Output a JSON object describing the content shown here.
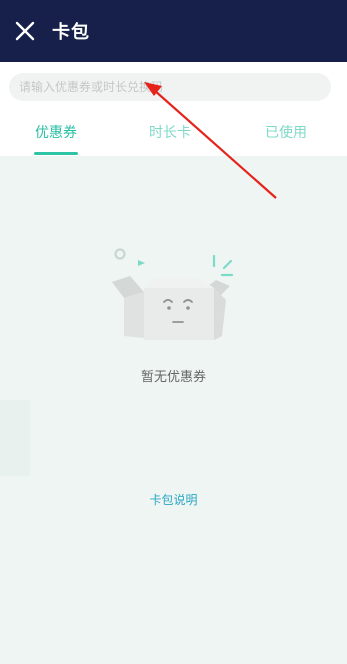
{
  "header": {
    "close_icon": "close-icon",
    "title": "卡包"
  },
  "search": {
    "placeholder": "请输入优惠券或时长兑换码",
    "value": ""
  },
  "tabs": [
    {
      "label": "优惠券",
      "active": true
    },
    {
      "label": "时长卡",
      "active": false
    },
    {
      "label": "已使用",
      "active": false
    }
  ],
  "empty_state": {
    "icon": "empty-box-icon",
    "message": "暂无优惠券"
  },
  "help": {
    "label": "卡包说明"
  },
  "colors": {
    "header_bg": "#17204a",
    "accent": "#2ec4a6",
    "link": "#2aa7c4",
    "page_bg": "#eef5f3",
    "annotation": "#e5231b"
  }
}
